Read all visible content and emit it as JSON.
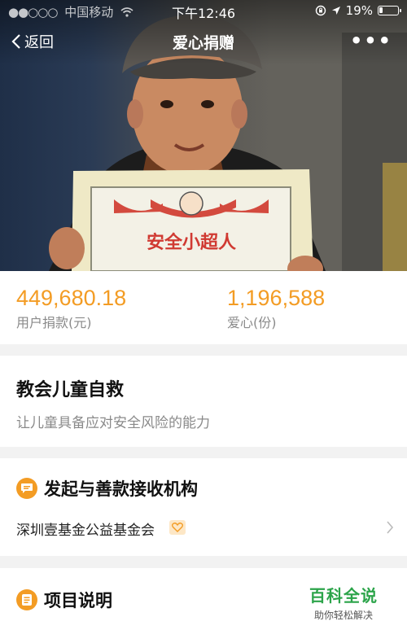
{
  "status_bar": {
    "carrier": "中国移动",
    "time": "下午12:46",
    "battery": "19%",
    "battery_level": 0.19
  },
  "nav": {
    "back_label": "返回",
    "title": "爱心捐赠",
    "more_label": "•••"
  },
  "stats": {
    "donations_value": "449,680.18",
    "donations_label": "用户捐款(元)",
    "hearts_value": "1,196,588",
    "hearts_label": "爱心(份)"
  },
  "project": {
    "title": "教会儿童自救",
    "subtitle": "让儿童具备应对安全风险的能力"
  },
  "sections": {
    "org_heading": "发起与善款接收机构",
    "org_name": "深圳壹基金公益基金会",
    "explain_heading": "项目说明"
  },
  "certificate": {
    "text": "安全小超人"
  },
  "watermark": {
    "title": "百科全说",
    "subtitle": "助你轻松解决"
  },
  "colors": {
    "accent": "#f39c24",
    "watermark": "#2ca44a"
  }
}
